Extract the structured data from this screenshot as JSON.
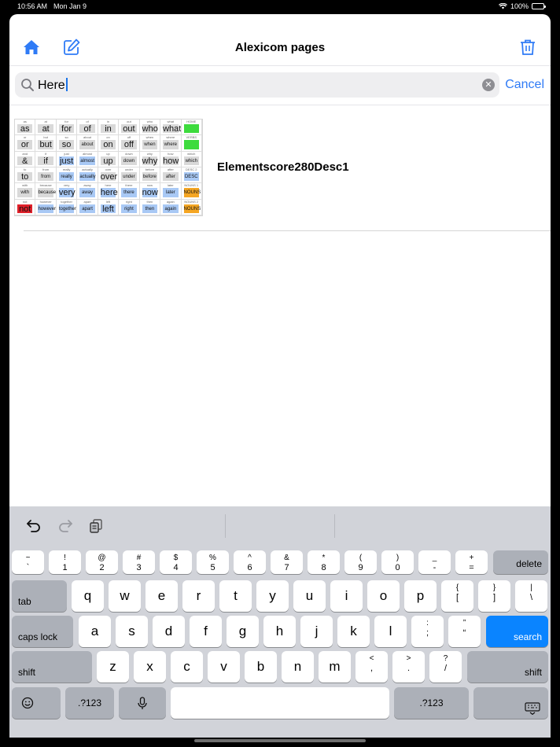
{
  "status": {
    "time": "10:56 AM",
    "date": "Mon Jan 9",
    "battery": "100%"
  },
  "nav": {
    "title": "Alexicom pages",
    "home_icon": "house-icon",
    "compose_icon": "square-pencil-icon",
    "delete_icon": "trash-icon"
  },
  "search": {
    "value": "Here",
    "cancel": "Cancel"
  },
  "results": [
    {
      "title": "Elementscore280Desc1"
    }
  ],
  "thumbnail": {
    "rows": [
      [
        {
          "t": "as",
          "w": "as"
        },
        {
          "t": "at",
          "w": "at"
        },
        {
          "t": "for",
          "w": "for"
        },
        {
          "t": "of",
          "w": "of"
        },
        {
          "t": "in",
          "w": "in"
        },
        {
          "t": "out",
          "w": "out"
        },
        {
          "t": "who",
          "w": "who"
        },
        {
          "t": "what",
          "w": "what"
        },
        {
          "t": "HOME",
          "w": "",
          "c": "#3ddb3d"
        }
      ],
      [
        {
          "t": "or",
          "w": "or"
        },
        {
          "t": "but",
          "w": "but"
        },
        {
          "t": "so",
          "w": "so"
        },
        {
          "t": "about",
          "w": "about",
          "s": 1
        },
        {
          "t": "on",
          "w": "on"
        },
        {
          "t": "off",
          "w": "off"
        },
        {
          "t": "when",
          "w": "when",
          "s": 1
        },
        {
          "t": "where",
          "w": "where",
          "s": 1
        },
        {
          "t": "VERBS",
          "w": "",
          "c": "#3ddb3d"
        }
      ],
      [
        {
          "t": "and",
          "w": "&"
        },
        {
          "t": "if",
          "w": "if"
        },
        {
          "t": "just",
          "w": "just",
          "b": 1
        },
        {
          "t": "almost",
          "w": "almost",
          "s": 1,
          "b": 1
        },
        {
          "t": "up",
          "w": "up"
        },
        {
          "t": "down",
          "w": "down",
          "s": 1
        },
        {
          "t": "why",
          "w": "why"
        },
        {
          "t": "how",
          "w": "how"
        },
        {
          "t": "which",
          "w": "which",
          "s": 1
        }
      ],
      [
        {
          "t": "to",
          "w": "to"
        },
        {
          "t": "from",
          "w": "from",
          "s": 1
        },
        {
          "t": "really",
          "w": "really",
          "s": 1,
          "b": 1
        },
        {
          "t": "actually",
          "w": "actually",
          "s": 1,
          "b": 1
        },
        {
          "t": "over",
          "w": "over"
        },
        {
          "t": "under",
          "w": "under",
          "s": 1
        },
        {
          "t": "before",
          "w": "before",
          "s": 1
        },
        {
          "t": "after",
          "w": "after",
          "s": 1
        },
        {
          "t": "DESC 2",
          "w": "DESC",
          "s": 1,
          "b": 1
        }
      ],
      [
        {
          "t": "with",
          "w": "with",
          "s": 1
        },
        {
          "t": "because",
          "w": "because",
          "s": 1
        },
        {
          "t": "very",
          "w": "very",
          "b": 1
        },
        {
          "t": "away",
          "w": "away",
          "s": 1,
          "b": 1
        },
        {
          "t": "here",
          "w": "here",
          "b": 1
        },
        {
          "t": "there",
          "w": "there",
          "s": 1,
          "b": 1
        },
        {
          "t": "now",
          "w": "now",
          "b": 1
        },
        {
          "t": "later",
          "w": "later",
          "s": 1,
          "b": 1
        },
        {
          "t": "NOUNS 1",
          "w": "NOUNS",
          "s": 1,
          "c": "#f5a623"
        }
      ],
      [
        {
          "t": "not",
          "w": "not",
          "c": "#e0202a"
        },
        {
          "t": "however",
          "w": "however",
          "s": 1,
          "b": 1
        },
        {
          "t": "together",
          "w": "together",
          "s": 1,
          "b": 1
        },
        {
          "t": "apart",
          "w": "apart",
          "s": 1,
          "b": 1
        },
        {
          "t": "left",
          "w": "left",
          "b": 1
        },
        {
          "t": "right",
          "w": "right",
          "s": 1,
          "b": 1
        },
        {
          "t": "then",
          "w": "then",
          "s": 1,
          "b": 1
        },
        {
          "t": "again",
          "w": "again",
          "s": 1,
          "b": 1
        },
        {
          "t": "NOUNS 2",
          "w": "NOUNS",
          "s": 1,
          "c": "#f5a623"
        }
      ]
    ]
  },
  "keyboard": {
    "row1": [
      [
        "~",
        "`"
      ],
      [
        "!",
        "1"
      ],
      [
        "@",
        "2"
      ],
      [
        "#",
        "3"
      ],
      [
        "$",
        "4"
      ],
      [
        "%",
        "5"
      ],
      [
        "^",
        "6"
      ],
      [
        "&",
        "7"
      ],
      [
        "*",
        "8"
      ],
      [
        "(",
        "9"
      ],
      [
        ")",
        "0"
      ],
      [
        "_",
        "-"
      ],
      [
        "+",
        "="
      ]
    ],
    "delete": "delete",
    "tab": "tab",
    "row2": [
      "q",
      "w",
      "e",
      "r",
      "t",
      "y",
      "u",
      "i",
      "o",
      "p"
    ],
    "row2_pairs": [
      [
        "{",
        "["
      ],
      [
        "}",
        "]"
      ],
      [
        "|",
        "\\"
      ]
    ],
    "caps": "caps lock",
    "row3": [
      "a",
      "s",
      "d",
      "f",
      "g",
      "h",
      "j",
      "k",
      "l"
    ],
    "row3_pairs": [
      [
        ":",
        ";"
      ],
      [
        "”",
        "“"
      ]
    ],
    "search": "search",
    "shift": "shift",
    "row4": [
      "z",
      "x",
      "c",
      "v",
      "b",
      "n",
      "m"
    ],
    "row4_pairs": [
      [
        "<",
        ","
      ],
      [
        ">",
        "."
      ],
      [
        "?",
        "/"
      ]
    ],
    "num": ".?123",
    "emoji_icon": "emoji-icon",
    "mic_icon": "microphone-icon",
    "hide_icon": "keyboard-hide-icon"
  }
}
